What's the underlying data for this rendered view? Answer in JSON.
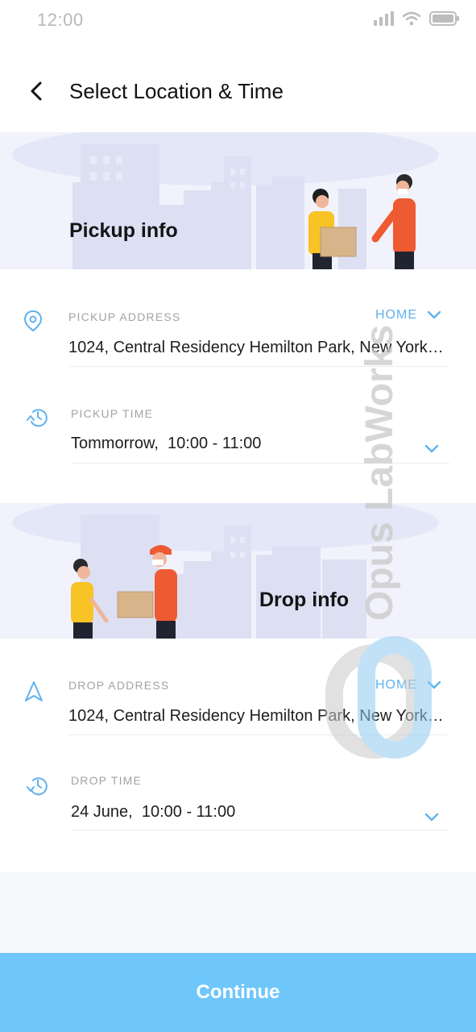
{
  "status_bar": {
    "time": "12:00"
  },
  "header": {
    "title": "Select Location & Time"
  },
  "pickup": {
    "banner_title": "Pickup info",
    "address_label": "PICKUP ADDRESS",
    "address_type": "HOME",
    "address_value": "1024, Central Residency Hemilton Park, New York, USA",
    "time_label": "PICKUP TIME",
    "time_value": "Tommorrow,  10:00 - 11:00"
  },
  "drop": {
    "banner_title": "Drop info",
    "address_label": "DROP ADDRESS",
    "address_type": "HOME",
    "address_value": "1024, Central Residency Hemilton Park, New York, USA",
    "time_label": "DROP TIME",
    "time_value": "24 June,  10:00 - 11:00"
  },
  "footer": {
    "continue_label": "Continue"
  },
  "watermark": {
    "text": "Opus LabWorks"
  },
  "colors": {
    "accent": "#5fb2ef",
    "button": "#6ec6fb",
    "banner_bg": "#f1f2fb"
  },
  "icons": [
    "back-arrow-icon",
    "location-pin-icon",
    "history-clock-icon",
    "navigation-arrow-icon",
    "chevron-down-icon",
    "signal-icon",
    "wifi-icon",
    "battery-icon"
  ]
}
